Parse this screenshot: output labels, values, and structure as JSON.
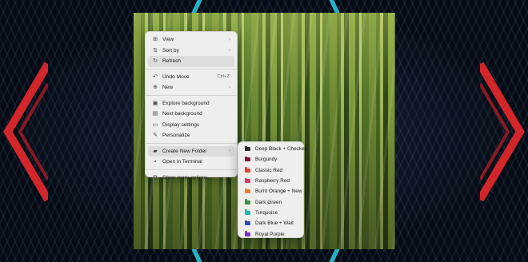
{
  "context_menu": {
    "items": [
      {
        "label": "View",
        "icon": "grid-icon",
        "has_submenu": true
      },
      {
        "label": "Sort by",
        "icon": "sort-icon",
        "has_submenu": true
      },
      {
        "label": "Refresh",
        "icon": "refresh-icon",
        "highlighted": true
      },
      {
        "label": "Undo Move",
        "icon": "undo-icon",
        "shortcut": "Ctrl+Z"
      },
      {
        "label": "New",
        "icon": "new-icon",
        "has_submenu": true
      },
      {
        "label": "Explore background",
        "icon": "image-icon"
      },
      {
        "label": "Next background",
        "icon": "next-image-icon"
      },
      {
        "label": "Display settings",
        "icon": "display-icon"
      },
      {
        "label": "Personalize",
        "icon": "brush-icon"
      },
      {
        "label": "Create New Folder",
        "icon": "folder-plus-icon",
        "has_submenu": true,
        "highlighted": true
      },
      {
        "label": "Open in Terminal",
        "icon": "terminal-icon"
      },
      {
        "label": "Show more options",
        "icon": "more-options-icon"
      }
    ]
  },
  "submenu": {
    "items": [
      {
        "label": "Deep Black + Checked",
        "color": "#2a2a2a"
      },
      {
        "label": "Burgundy",
        "color": "#7a1532"
      },
      {
        "label": "Classic Red",
        "color": "#e0403a"
      },
      {
        "label": "Raspberry Red",
        "color": "#d83a63"
      },
      {
        "label": "Burnt Orange + New",
        "color": "#e6832a"
      },
      {
        "label": "Dark Green",
        "color": "#3f8f45"
      },
      {
        "label": "Turquoise",
        "color": "#1fb6b0"
      },
      {
        "label": "Dark Blue + Wait",
        "color": "#2a4fb0"
      },
      {
        "label": "Royal Purple",
        "color": "#7b2cc0"
      }
    ]
  }
}
